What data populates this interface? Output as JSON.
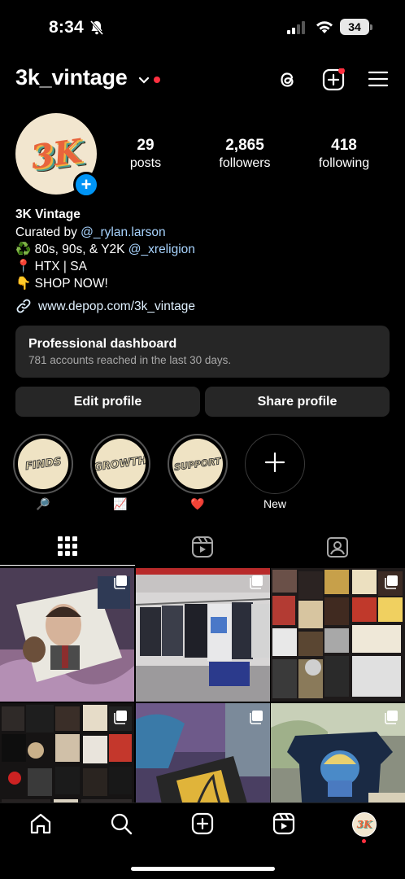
{
  "status": {
    "time": "8:34",
    "battery": "34"
  },
  "header": {
    "username": "3k_vintage"
  },
  "profile": {
    "avatar_text": "3K",
    "stats": [
      {
        "num": "29",
        "label": "posts"
      },
      {
        "num": "2,865",
        "label": "followers"
      },
      {
        "num": "418",
        "label": "following"
      }
    ]
  },
  "bio": {
    "name": "3K Vintage",
    "curated_prefix": "Curated by ",
    "curated_mention": "@_rylan.larson",
    "line2_emoji": "♻️",
    "line2_text": " 80s, 90s, & Y2K ",
    "line2_mention": "@_xreligion",
    "line3_emoji": "📍",
    "line3_text": " HTX | SA",
    "line4_emoji": "👇",
    "line4_text": " SHOP NOW!",
    "link": "www.depop.com/3k_vintage"
  },
  "dashboard": {
    "title": "Professional dashboard",
    "subtitle": "781 accounts reached in the last 30 days."
  },
  "buttons": {
    "edit": "Edit profile",
    "share": "Share profile"
  },
  "highlights": [
    {
      "cover": "FINDS",
      "label": "🔎"
    },
    {
      "cover": "GROWTH",
      "label": "📈"
    },
    {
      "cover": "SUPPORT",
      "label": "❤️"
    },
    {
      "cover": "",
      "label": "New"
    }
  ],
  "grid_posts": [
    {
      "subject": "mr-bean-tee",
      "bg": "#6a5a6e"
    },
    {
      "subject": "shop-rack",
      "bg": "#8a8a8e"
    },
    {
      "subject": "graphic-tees-collage",
      "bg": "#3c2f2c"
    },
    {
      "subject": "band-tees-collage",
      "bg": "#2c2a2a"
    },
    {
      "subject": "yellow-graphic-tee",
      "bg": "#3d3550"
    },
    {
      "subject": "anime-tee",
      "bg": "#41506a"
    }
  ],
  "colors": {
    "accent": "#0095f6",
    "notification": "#ff3040",
    "card": "#262626",
    "link": "#e0f1ff"
  }
}
